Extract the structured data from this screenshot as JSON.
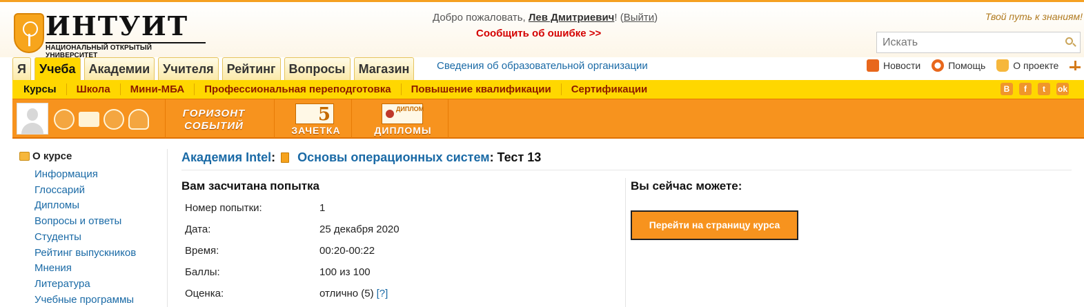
{
  "header": {
    "logo": {
      "word": "ИНТУИТ",
      "subtitle": "НАЦИОНАЛЬНЫЙ ОТКРЫТЫЙ УНИВЕРСИТЕТ"
    },
    "welcome_prefix": "Добро пожаловать, ",
    "user_name": "Лев Дмитриевич",
    "welcome_suffix_open": "! (",
    "logout_label": "Выйти",
    "welcome_suffix_close": ")",
    "report_error": "Сообщить об ошибке >>",
    "slogan": "Твой путь к знаниям!",
    "search": {
      "placeholder": "Искать"
    }
  },
  "main_tabs": [
    {
      "label": "Я",
      "active": false
    },
    {
      "label": "Учеба",
      "active": true
    },
    {
      "label": "Академии",
      "active": false
    },
    {
      "label": "Учителя",
      "active": false
    },
    {
      "label": "Рейтинг",
      "active": false
    },
    {
      "label": "Вопросы",
      "active": false
    },
    {
      "label": "Магазин",
      "active": false
    }
  ],
  "org_info_link": "Сведения об образовательной организации",
  "right_links": {
    "news": "Новости",
    "help": "Помощь",
    "about": "О проекте"
  },
  "subnav": [
    "Курсы",
    "Школа",
    "Мини-МБА",
    "Профессиональная переподготовка",
    "Повышение квалификации",
    "Сертификации"
  ],
  "social": [
    "В",
    "f",
    "t",
    "ok"
  ],
  "toolbar": {
    "gorizont_line1": "ГОРИЗОНТ",
    "gorizont_line2": "СОБЫТИЙ",
    "zachetka": "ЗАЧЕТКА",
    "diplomy": "ДИПЛОМЫ",
    "diploma_icon_caption": "ДИПЛОМ"
  },
  "sidebar": {
    "heading": "О курсе",
    "items": [
      "Информация",
      "Глоссарий",
      "Дипломы",
      "Вопросы и ответы",
      "Студенты",
      "Рейтинг выпускников",
      "Мнения",
      "Литература",
      "Учебные программы"
    ]
  },
  "breadcrumb": {
    "academy": "Академия Intel",
    "sep": ":",
    "course": "Основы операционных систем",
    "test": ": Тест 13"
  },
  "attempt": {
    "title": "Вам засчитана попытка",
    "rows": [
      {
        "label": "Номер попытки:",
        "value": "1"
      },
      {
        "label": "Дата:",
        "value": "25 декабря 2020"
      },
      {
        "label": "Время:",
        "value": "00:20-00:22"
      },
      {
        "label": "Баллы:",
        "value": "100 из 100"
      },
      {
        "label": "Оценка:",
        "value": "отлично (5)"
      }
    ],
    "grade_help": "[?]"
  },
  "actions": {
    "title": "Вы сейчас можете:",
    "go_course": "Перейти на страницу курса"
  },
  "colors": {
    "accent_orange": "#f7931e",
    "tab_yellow": "#ffd700",
    "link_blue": "#1a6aa6",
    "alert_red": "#d40000"
  }
}
